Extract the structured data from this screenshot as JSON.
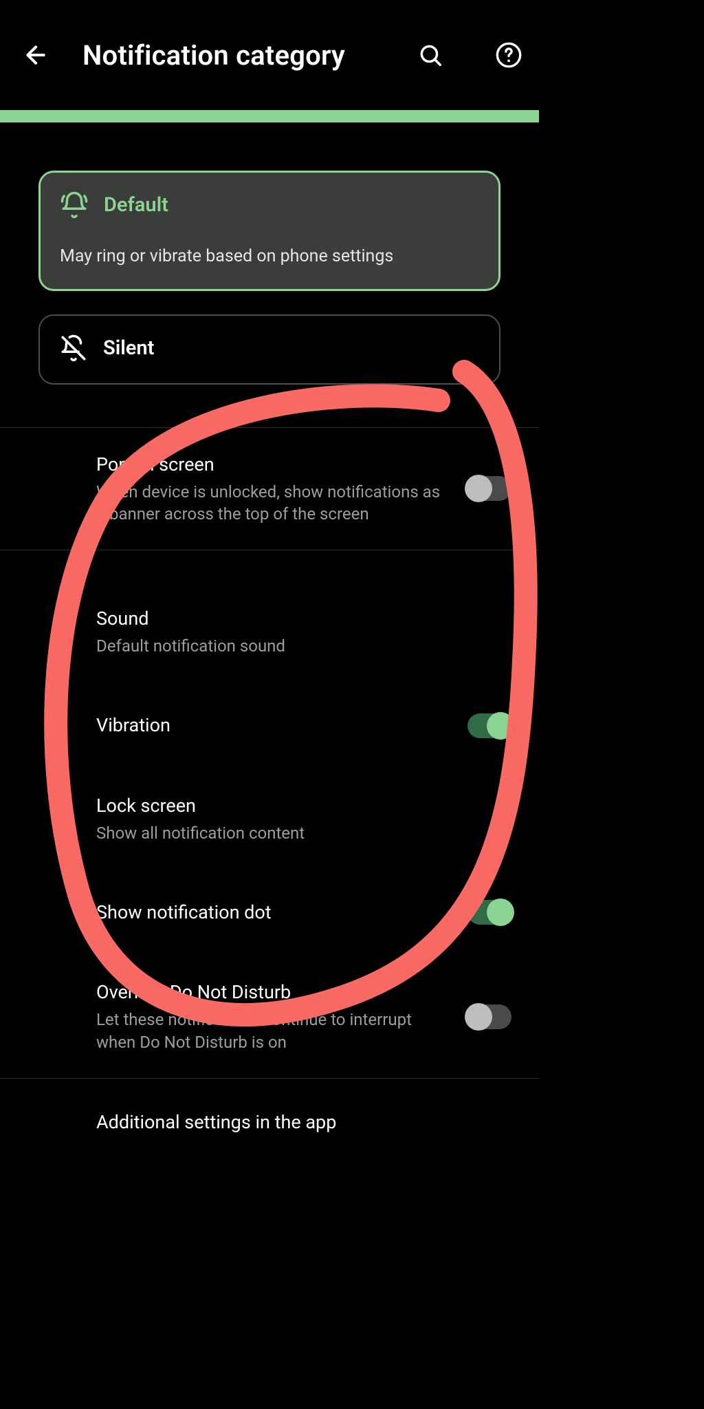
{
  "header": {
    "title": "Notification category"
  },
  "modes": {
    "default": {
      "title": "Default",
      "desc": "May ring or vibrate based on phone settings"
    },
    "silent": {
      "title": "Silent"
    }
  },
  "rows": {
    "pop": {
      "label": "Pop on screen",
      "sub": "When device is unlocked, show notifications as a banner across the top of the screen"
    },
    "sound": {
      "label": "Sound",
      "sub": "Default notification sound"
    },
    "vibration": {
      "label": "Vibration"
    },
    "lock": {
      "label": "Lock screen",
      "sub": "Show all notification content"
    },
    "dot": {
      "label": "Show notification dot"
    },
    "dnd": {
      "label": "Override Do Not Disturb",
      "sub": "Let these notifications continue to interrupt when Do Not Disturb is on"
    },
    "additional": {
      "label": "Additional settings in the app"
    }
  }
}
